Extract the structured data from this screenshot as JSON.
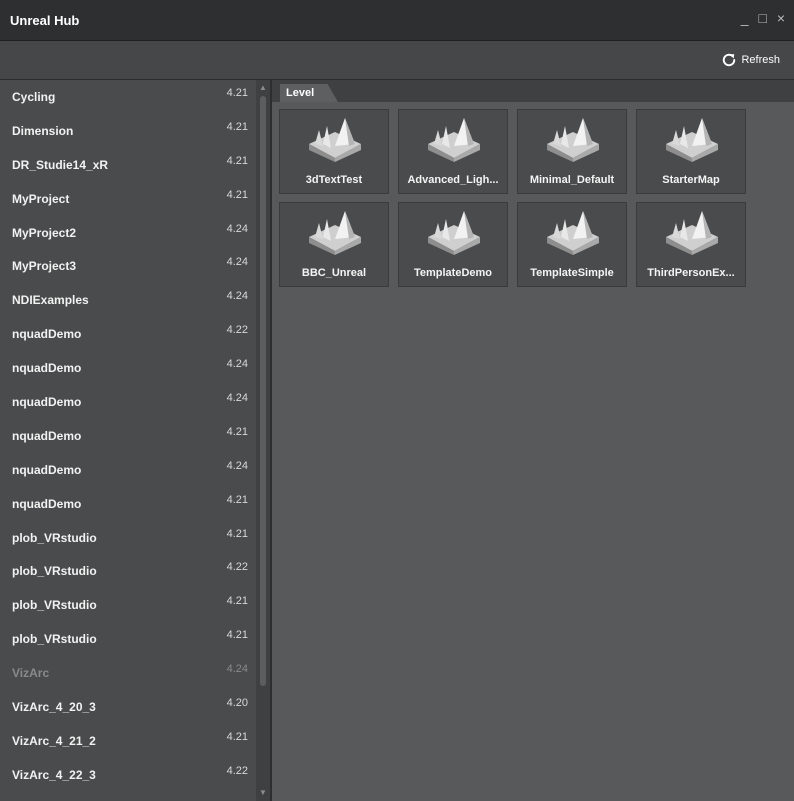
{
  "window": {
    "title": "Unreal Hub",
    "controls": [
      "_",
      "□",
      "×"
    ]
  },
  "toolbar": {
    "refresh_label": "Refresh"
  },
  "projects": [
    {
      "name": "Cycling",
      "version": "4.21"
    },
    {
      "name": "Dimension",
      "version": "4.21"
    },
    {
      "name": "DR_Studie14_xR",
      "version": "4.21"
    },
    {
      "name": "MyProject",
      "version": "4.21"
    },
    {
      "name": "MyProject2",
      "version": "4.24"
    },
    {
      "name": "MyProject3",
      "version": "4.24"
    },
    {
      "name": "NDIExamples",
      "version": "4.24"
    },
    {
      "name": "nquadDemo",
      "version": "4.22"
    },
    {
      "name": "nquadDemo",
      "version": "4.24"
    },
    {
      "name": "nquadDemo",
      "version": "4.24"
    },
    {
      "name": "nquadDemo",
      "version": "4.21"
    },
    {
      "name": "nquadDemo",
      "version": "4.24"
    },
    {
      "name": "nquadDemo",
      "version": "4.21"
    },
    {
      "name": "plob_VRstudio",
      "version": "4.21"
    },
    {
      "name": "plob_VRstudio",
      "version": "4.22"
    },
    {
      "name": "plob_VRstudio",
      "version": "4.21"
    },
    {
      "name": "plob_VRstudio",
      "version": "4.21"
    },
    {
      "name": "VizArc",
      "version": "4.24",
      "dimmed": true
    },
    {
      "name": "VizArc_4_20_3",
      "version": "4.20"
    },
    {
      "name": "VizArc_4_21_2",
      "version": "4.21"
    },
    {
      "name": "VizArc_4_22_3",
      "version": "4.22"
    }
  ],
  "main": {
    "tab_label": "Level",
    "levels": [
      {
        "name": "3dTextTest"
      },
      {
        "name": "Advanced_Ligh..."
      },
      {
        "name": "Minimal_Default"
      },
      {
        "name": "StarterMap"
      },
      {
        "name": "BBC_Unreal"
      },
      {
        "name": "TemplateDemo"
      },
      {
        "name": "TemplateSimple"
      },
      {
        "name": "ThirdPersonEx..."
      }
    ]
  },
  "icons": {
    "level_thumbnail": "level-map-icon",
    "refresh": "refresh-icon",
    "scroll_up": "scroll-up-arrow-icon",
    "scroll_down": "scroll-down-arrow-icon"
  },
  "colors": {
    "titlebar": "#2e2f30",
    "sidebar": "#4a4b4c",
    "content": "#58595a",
    "tile": "#4a4b4c"
  }
}
